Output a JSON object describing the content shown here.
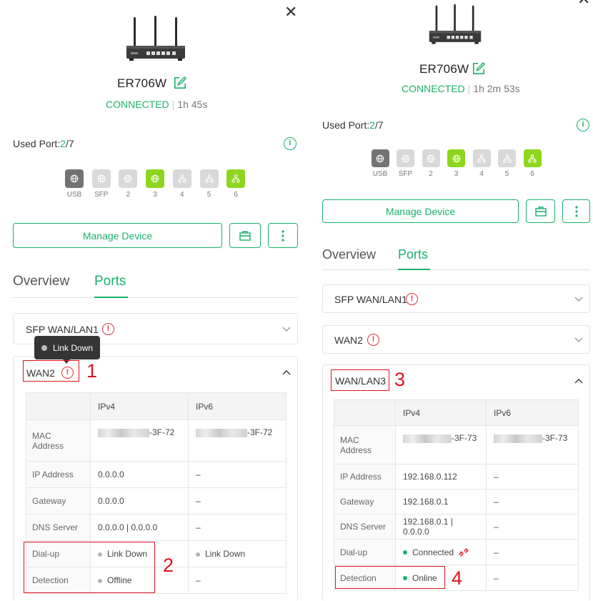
{
  "left": {
    "device_name": "ER706W",
    "status": "CONNECTED",
    "uptime": "1h 45s",
    "used_port_label": "Used Port:",
    "used_port_used": "2",
    "used_port_total": "/7",
    "ports": [
      {
        "label": "USB",
        "state": "dark",
        "icon": "globe-icon"
      },
      {
        "label": "SFP",
        "state": "light",
        "icon": "globe-icon"
      },
      {
        "label": "2",
        "state": "light",
        "icon": "globe-icon"
      },
      {
        "label": "3",
        "state": "green",
        "icon": "globe-icon"
      },
      {
        "label": "4",
        "state": "light",
        "icon": "network-icon"
      },
      {
        "label": "5",
        "state": "light",
        "icon": "network-icon"
      },
      {
        "label": "6",
        "state": "green",
        "icon": "network-icon"
      }
    ],
    "manage_label": "Manage Device",
    "tabs": [
      "Overview",
      "Ports"
    ],
    "sections": [
      "SFP WAN/LAN1",
      "WAN2"
    ],
    "tooltip": "Link Down",
    "table": {
      "headers": [
        "",
        "IPv4",
        "IPv6"
      ],
      "mac_label": "MAC Address",
      "mac_v4_suffix": "-3F-72",
      "mac_v6_suffix": "-3F-72",
      "rows": [
        {
          "label": "IP Address",
          "v4": "0.0.0.0",
          "v6": "–"
        },
        {
          "label": "Gateway",
          "v4": "0.0.0.0",
          "v6": "–"
        },
        {
          "label": "DNS Server",
          "v4": "0.0.0.0 | 0.0.0.0",
          "v6": "–"
        }
      ],
      "dialup_label": "Dial-up",
      "dialup_v4": "Link Down",
      "dialup_v6": "Link Down",
      "detection_label": "Detection",
      "detection_v4": "Offline",
      "detection_v6": "–"
    },
    "markers": [
      "1",
      "2"
    ]
  },
  "right": {
    "device_name": "ER706W",
    "status": "CONNECTED",
    "uptime": "1h 2m 53s",
    "used_port_label": "Used Port:",
    "used_port_used": "2",
    "used_port_total": "/7",
    "ports": [
      {
        "label": "USB",
        "state": "dark",
        "icon": "globe-icon"
      },
      {
        "label": "SFP",
        "state": "light",
        "icon": "globe-icon"
      },
      {
        "label": "2",
        "state": "light",
        "icon": "globe-icon"
      },
      {
        "label": "3",
        "state": "green",
        "icon": "globe-icon"
      },
      {
        "label": "4",
        "state": "light",
        "icon": "network-icon"
      },
      {
        "label": "5",
        "state": "light",
        "icon": "network-icon"
      },
      {
        "label": "6",
        "state": "green",
        "icon": "network-icon"
      }
    ],
    "manage_label": "Manage Device",
    "tabs": [
      "Overview",
      "Ports"
    ],
    "sections": [
      "SFP WAN/LAN1",
      "WAN2",
      "WAN/LAN3"
    ],
    "table": {
      "headers": [
        "",
        "IPv4",
        "IPv6"
      ],
      "mac_label": "MAC Address",
      "mac_v4_suffix": "-3F-73",
      "mac_v6_suffix": "-3F-73",
      "rows": [
        {
          "label": "IP Address",
          "v4": "192.168.0.112",
          "v6": "–"
        },
        {
          "label": "Gateway",
          "v4": "192.168.0.1",
          "v6": "–"
        },
        {
          "label": "DNS Server",
          "v4": "192.168.0.1 | 0.0.0.0",
          "v6": "–"
        }
      ],
      "dialup_label": "Dial-up",
      "dialup_v4": "Connected",
      "dialup_v6": "–",
      "detection_label": "Detection",
      "detection_v4": "Online",
      "detection_v6": "–"
    },
    "markers": [
      "3",
      "4"
    ]
  },
  "colors": {
    "accent": "#19b26b",
    "warning": "#e0333f",
    "annotation": "#e0121f",
    "port_active": "#8ed61e"
  }
}
